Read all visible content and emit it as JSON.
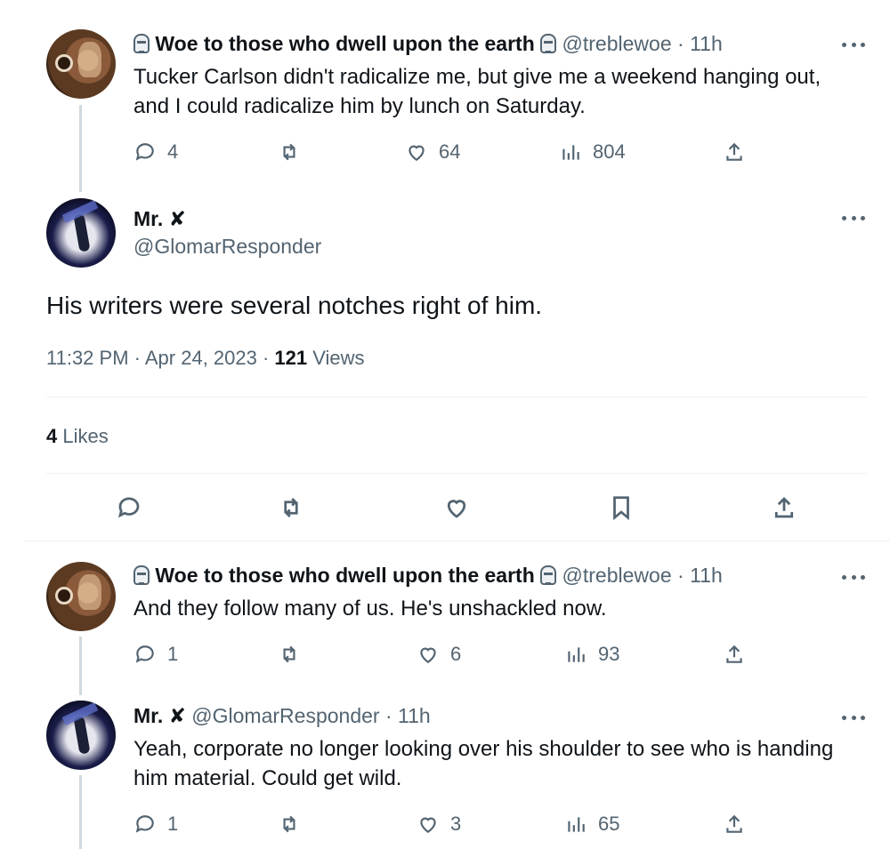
{
  "reply1": {
    "display_name": "Woe to those who dwell upon the earth",
    "handle": "@treblewoe",
    "time": "11h",
    "text_line1": "Tucker Carlson didn't radicalize me, but give me a weekend hanging out,",
    "text_line2": "and I could radicalize him by lunch on Saturday.",
    "replies": "4",
    "likes": "64",
    "views": "804"
  },
  "main": {
    "display_name": "Mr.",
    "name_badge": "✘",
    "handle": "@GlomarResponder",
    "text": "His writers were several notches right of him.",
    "timestamp": "11:32 PM · Apr 24, 2023 · ",
    "views_count": "121",
    "views_label": " Views",
    "likes_count": "4",
    "likes_label": " Likes"
  },
  "reply2": {
    "display_name": "Woe to those who dwell upon the earth",
    "handle": "@treblewoe",
    "time": "11h",
    "text": "And they follow many of us. He's unshackled now.",
    "replies": "1",
    "likes": "6",
    "views": "93"
  },
  "reply3": {
    "display_name": "Mr.",
    "name_badge": "✘",
    "handle": "@GlomarResponder",
    "time": "11h",
    "text_line1": "Yeah, corporate no longer looking over his shoulder to see who is handing",
    "text_line2": "him material. Could get wild.",
    "replies": "1",
    "likes": "3",
    "views": "65"
  },
  "separator": " · ",
  "colors": {
    "text": "#0f1419",
    "muted": "#536471",
    "divider": "#eff3f4",
    "thread": "#cfd9de"
  }
}
